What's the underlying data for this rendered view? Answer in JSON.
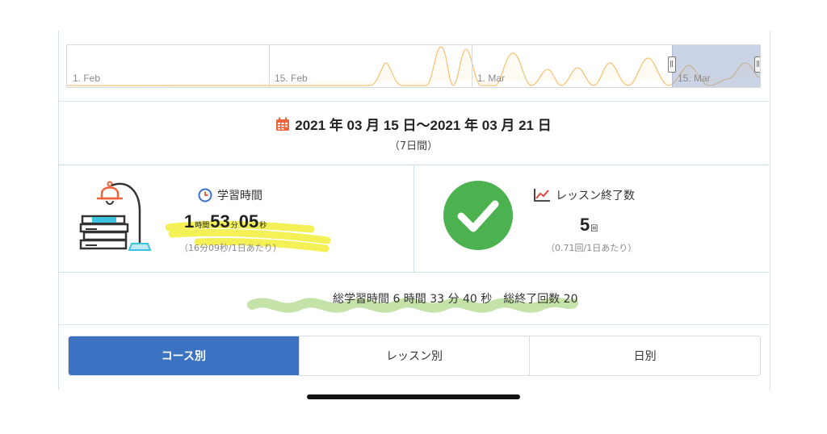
{
  "timeline": {
    "labels": [
      "1. Feb",
      "15. Feb",
      "1. Mar",
      "15. Mar"
    ]
  },
  "date_range": {
    "text": "2021 年 03 月 15 日〜2021 年 03 月 21 日",
    "duration": "（7日間）"
  },
  "study": {
    "label": "学習時間",
    "hours": "1",
    "hours_unit": "時間",
    "minutes": "53",
    "minutes_unit": "分",
    "seconds": "05",
    "seconds_unit": "秒",
    "per_day": "（16分09秒/1日あたり）"
  },
  "lessons": {
    "label": "レッスン終了数",
    "count": "5",
    "count_unit": "回",
    "per_day": "（0.71回/1日あたり）"
  },
  "totals": {
    "text": "総学習時間 6 時間 33 分 40 秒　総終了回数 20"
  },
  "tabs": [
    {
      "label": "コース別",
      "active": true
    },
    {
      "label": "レッスン別",
      "active": false
    },
    {
      "label": "日別",
      "active": false
    }
  ],
  "colors": {
    "accent": "#3b72c1",
    "check_green": "#4cb24f",
    "highlight_yellow": "#f2ee3a",
    "highlight_green": "#bfe0a0",
    "lamp_orange": "#f0643c"
  }
}
